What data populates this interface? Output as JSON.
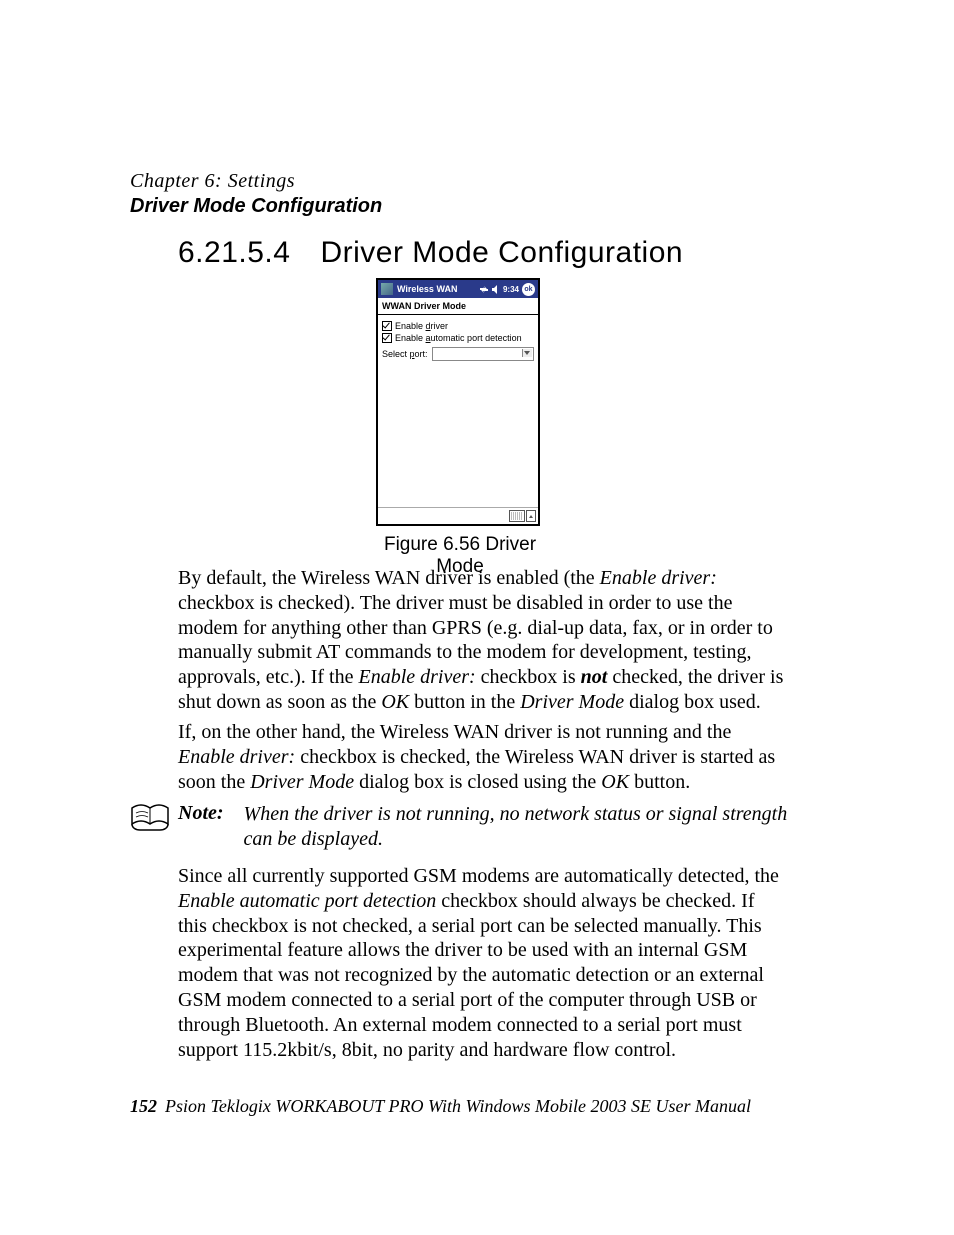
{
  "running": {
    "chapter": "Chapter 6: Settings",
    "section": "Driver Mode Configuration"
  },
  "heading": {
    "number": "6.21.5.4",
    "title": "Driver Mode Configuration"
  },
  "screenshot": {
    "window_title": "Wireless WAN",
    "time": "9:34",
    "ok": "ok",
    "subhead": "WWAN Driver Mode",
    "cb1_pre": "Enable ",
    "cb1_u": "d",
    "cb1_post": "river",
    "cb2_pre": "Enable ",
    "cb2_u": "a",
    "cb2_post": "utomatic port detection",
    "port_pre": "Select ",
    "port_u": "p",
    "port_post": "ort:"
  },
  "figure_caption": "Figure 6.56 Driver Mode",
  "p1": {
    "a": "By default, the Wireless WAN driver is enabled (the ",
    "b": "Enable driver:",
    "c": " checkbox is checked). The driver must be disabled in order to use the modem for anything other than GPRS (e.g. dial-up data, fax, or in order to manually submit AT commands to the modem for development, testing, approvals, etc.). If the ",
    "d": "Enable driver:",
    "e": " checkbox is ",
    "f": "not",
    "g": " checked, the driver is shut down as soon as the ",
    "h": "OK",
    "i": " button in the ",
    "j": "Driver Mode",
    "k": " dialog box used."
  },
  "p2": {
    "a": "If, on the other hand, the Wireless WAN driver is not running and the ",
    "b": "Enable driver:",
    "c": " checkbox is checked, the Wireless WAN driver is started as soon the ",
    "d": "Driver Mode",
    "e": " dialog box is closed using the ",
    "f": "OK",
    "g": " button."
  },
  "note": {
    "label": "Note:",
    "text": "When the driver is not running, no network status or signal strength can be displayed."
  },
  "p3": {
    "a": "Since all currently supported GSM modems are automatically detected, the ",
    "b": "Enable automatic port detection",
    "c": " checkbox should always be checked. If this checkbox is not checked, a serial port can be selected manually. This experimental feature allows the driver to be used with an internal GSM modem that was not recognized by the automatic detection or an external GSM modem connected to a serial port of the computer through USB or through Bluetooth. An external modem connected to a serial port must support 115.2kbit/s, 8bit, no parity and hardware flow control."
  },
  "footer": {
    "page": "152",
    "text": "Psion Teklogix WORKABOUT PRO With Windows Mobile 2003 SE User Manual"
  }
}
